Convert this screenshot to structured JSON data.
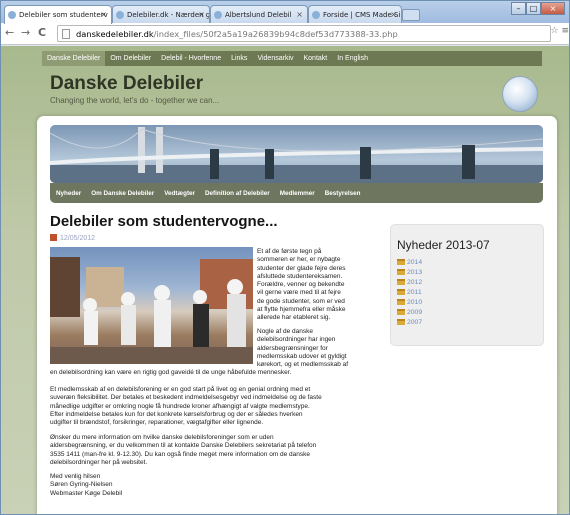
{
  "browser": {
    "tabs": [
      {
        "label": "Delebiler som studenterv",
        "active": true
      },
      {
        "label": "Delebiler.dk - Nærden gro",
        "active": false
      },
      {
        "label": "Albertslund Delebil",
        "active": false
      },
      {
        "label": "Forside | CMS Made Simpl",
        "active": false
      }
    ],
    "url_host": "danskedelebiler.dk",
    "url_path": "/index_files/50f2a5a19a26839b94c8def53d773388-33.php",
    "controls": {
      "back": "←",
      "forward": "→",
      "reload": "C"
    }
  },
  "site": {
    "nav": [
      "Danske Delebiler",
      "Om Delebiler",
      "Delebil - Hvorfenne",
      "Links",
      "Vidensarkiv",
      "Kontakt",
      "In English"
    ],
    "title": "Danske Delebiler",
    "slogan": "Changing the world, let's do - together we can...",
    "submenu": [
      "Nyheder",
      "Om Danske Delebiler",
      "Vedtægter",
      "Definition af Delebiler",
      "Medlemmer",
      "Bestyrelsen"
    ]
  },
  "article": {
    "title": "Delebiler som studentervogne...",
    "date": "12/05/2012",
    "para1_lines": [
      "Et af de første tegn på",
      "sommeren er her, er nybagte",
      "studenter der glade fejre deres",
      "afsluttede studentereksamen.",
      "Forældre, venner og bekendte",
      "vil gerne være med til at fejre",
      "de gode studenter, som er ved",
      "at flytte hjemmefra eller måske",
      "allerede har etableret sig."
    ],
    "para2_lines": [
      "Nogle af de danske",
      "delebilsordninger har ingen",
      "aldersbegrænsninger for",
      "medlemsskab udover et gyldigt",
      "kørekort, og et medlemsskab af"
    ],
    "para2_end": "en delebilsordning kan være en rigtig god gaveidé til de unge håbefulde mennesker.",
    "para3_lines": [
      "Et medlemsskab af en delebilsforening er en god start på livet og en genial ordning med et",
      "suveræn fleksibilitet. Der betales et beskedent indmeldelsesgebyr ved indmeldelse og de faste",
      "månedlige udgifter er omkring nogle få hundrede kroner afhængigt af valgte medlemstype.",
      "Efter indmeldelse betales kun for det konkrete kørselsforbrug og der er således hverken",
      "udgifter til brændstof, forsikringer, reparationer, vægtafgifter eller lignende."
    ],
    "para4_lines": [
      "Ønsker du mere information om hvilke danske delebilsforeninger som er uden",
      "aldersbegrænsning, er du velkommen til at kontakte Danske Delebilers sekretariat på telefon",
      "3535 1411 (man-fre kl. 9-12.30). Du kan også finde meget mere information om de danske",
      "delebilsordninger her på websitet."
    ],
    "sign_lines": [
      "Med venlig hilsen",
      "Søren Gyring-Nielsen",
      "Webmaster Køge Delebil"
    ]
  },
  "sidebar": {
    "title": "Nyheder 2013-07",
    "years": [
      "2014",
      "2013",
      "2012",
      "2011",
      "2010",
      "2009",
      "2007"
    ]
  }
}
